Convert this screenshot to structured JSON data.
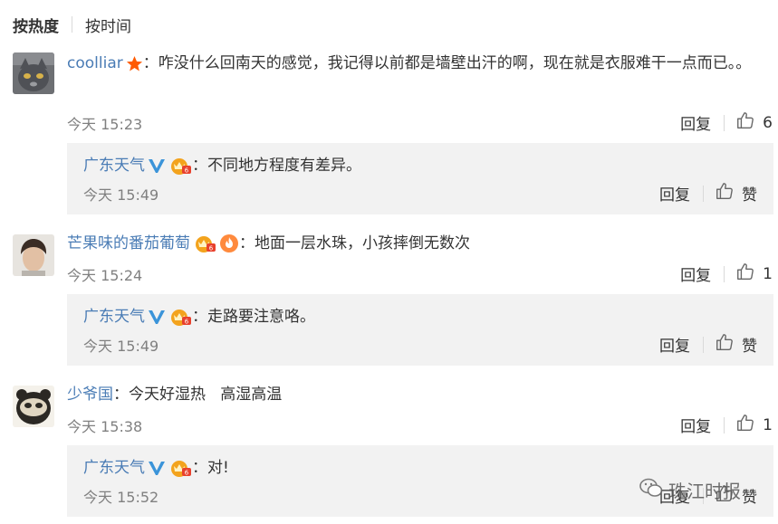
{
  "sort": {
    "hot": "按热度",
    "time": "按时间"
  },
  "comments": [
    {
      "user": "coolliar",
      "colon": "：",
      "text": "咋没什么回南天的感觉，我记得以前都是墙壁出汗的啊，现在就是衣服难干一点而已。。",
      "time": "今天 15:23",
      "reply_label": "回复",
      "likes": "6",
      "reply": {
        "user": "广东天气",
        "colon": "：",
        "text": "不同地方程度有差异。",
        "time": "今天 15:49",
        "reply_label": "回复",
        "like_label": "赞"
      }
    },
    {
      "user": "芒果味的番茄葡萄",
      "colon": "：",
      "text": "地面一层水珠，小孩摔倒无数次",
      "time": "今天 15:24",
      "reply_label": "回复",
      "likes": "1",
      "reply": {
        "user": "广东天气",
        "colon": "：",
        "text": "走路要注意咯。",
        "time": "今天 15:49",
        "reply_label": "回复",
        "like_label": "赞"
      }
    },
    {
      "user": "少爷国",
      "colon": "：",
      "text": "今天好湿热   高湿高温",
      "time": "今天 15:38",
      "reply_label": "回复",
      "likes": "1",
      "reply": {
        "user": "广东天气",
        "colon": "：",
        "text": "对!",
        "time": "今天 15:52",
        "reply_label": "回复",
        "like_label": "赞"
      }
    }
  ],
  "watermark": {
    "text": "珠江时报"
  },
  "colors": {
    "username": "#4a7cb5",
    "reply_bg": "#f2f2f2",
    "meta": "#808080",
    "verified": "#3b94d9",
    "star": "#ff6a00"
  }
}
